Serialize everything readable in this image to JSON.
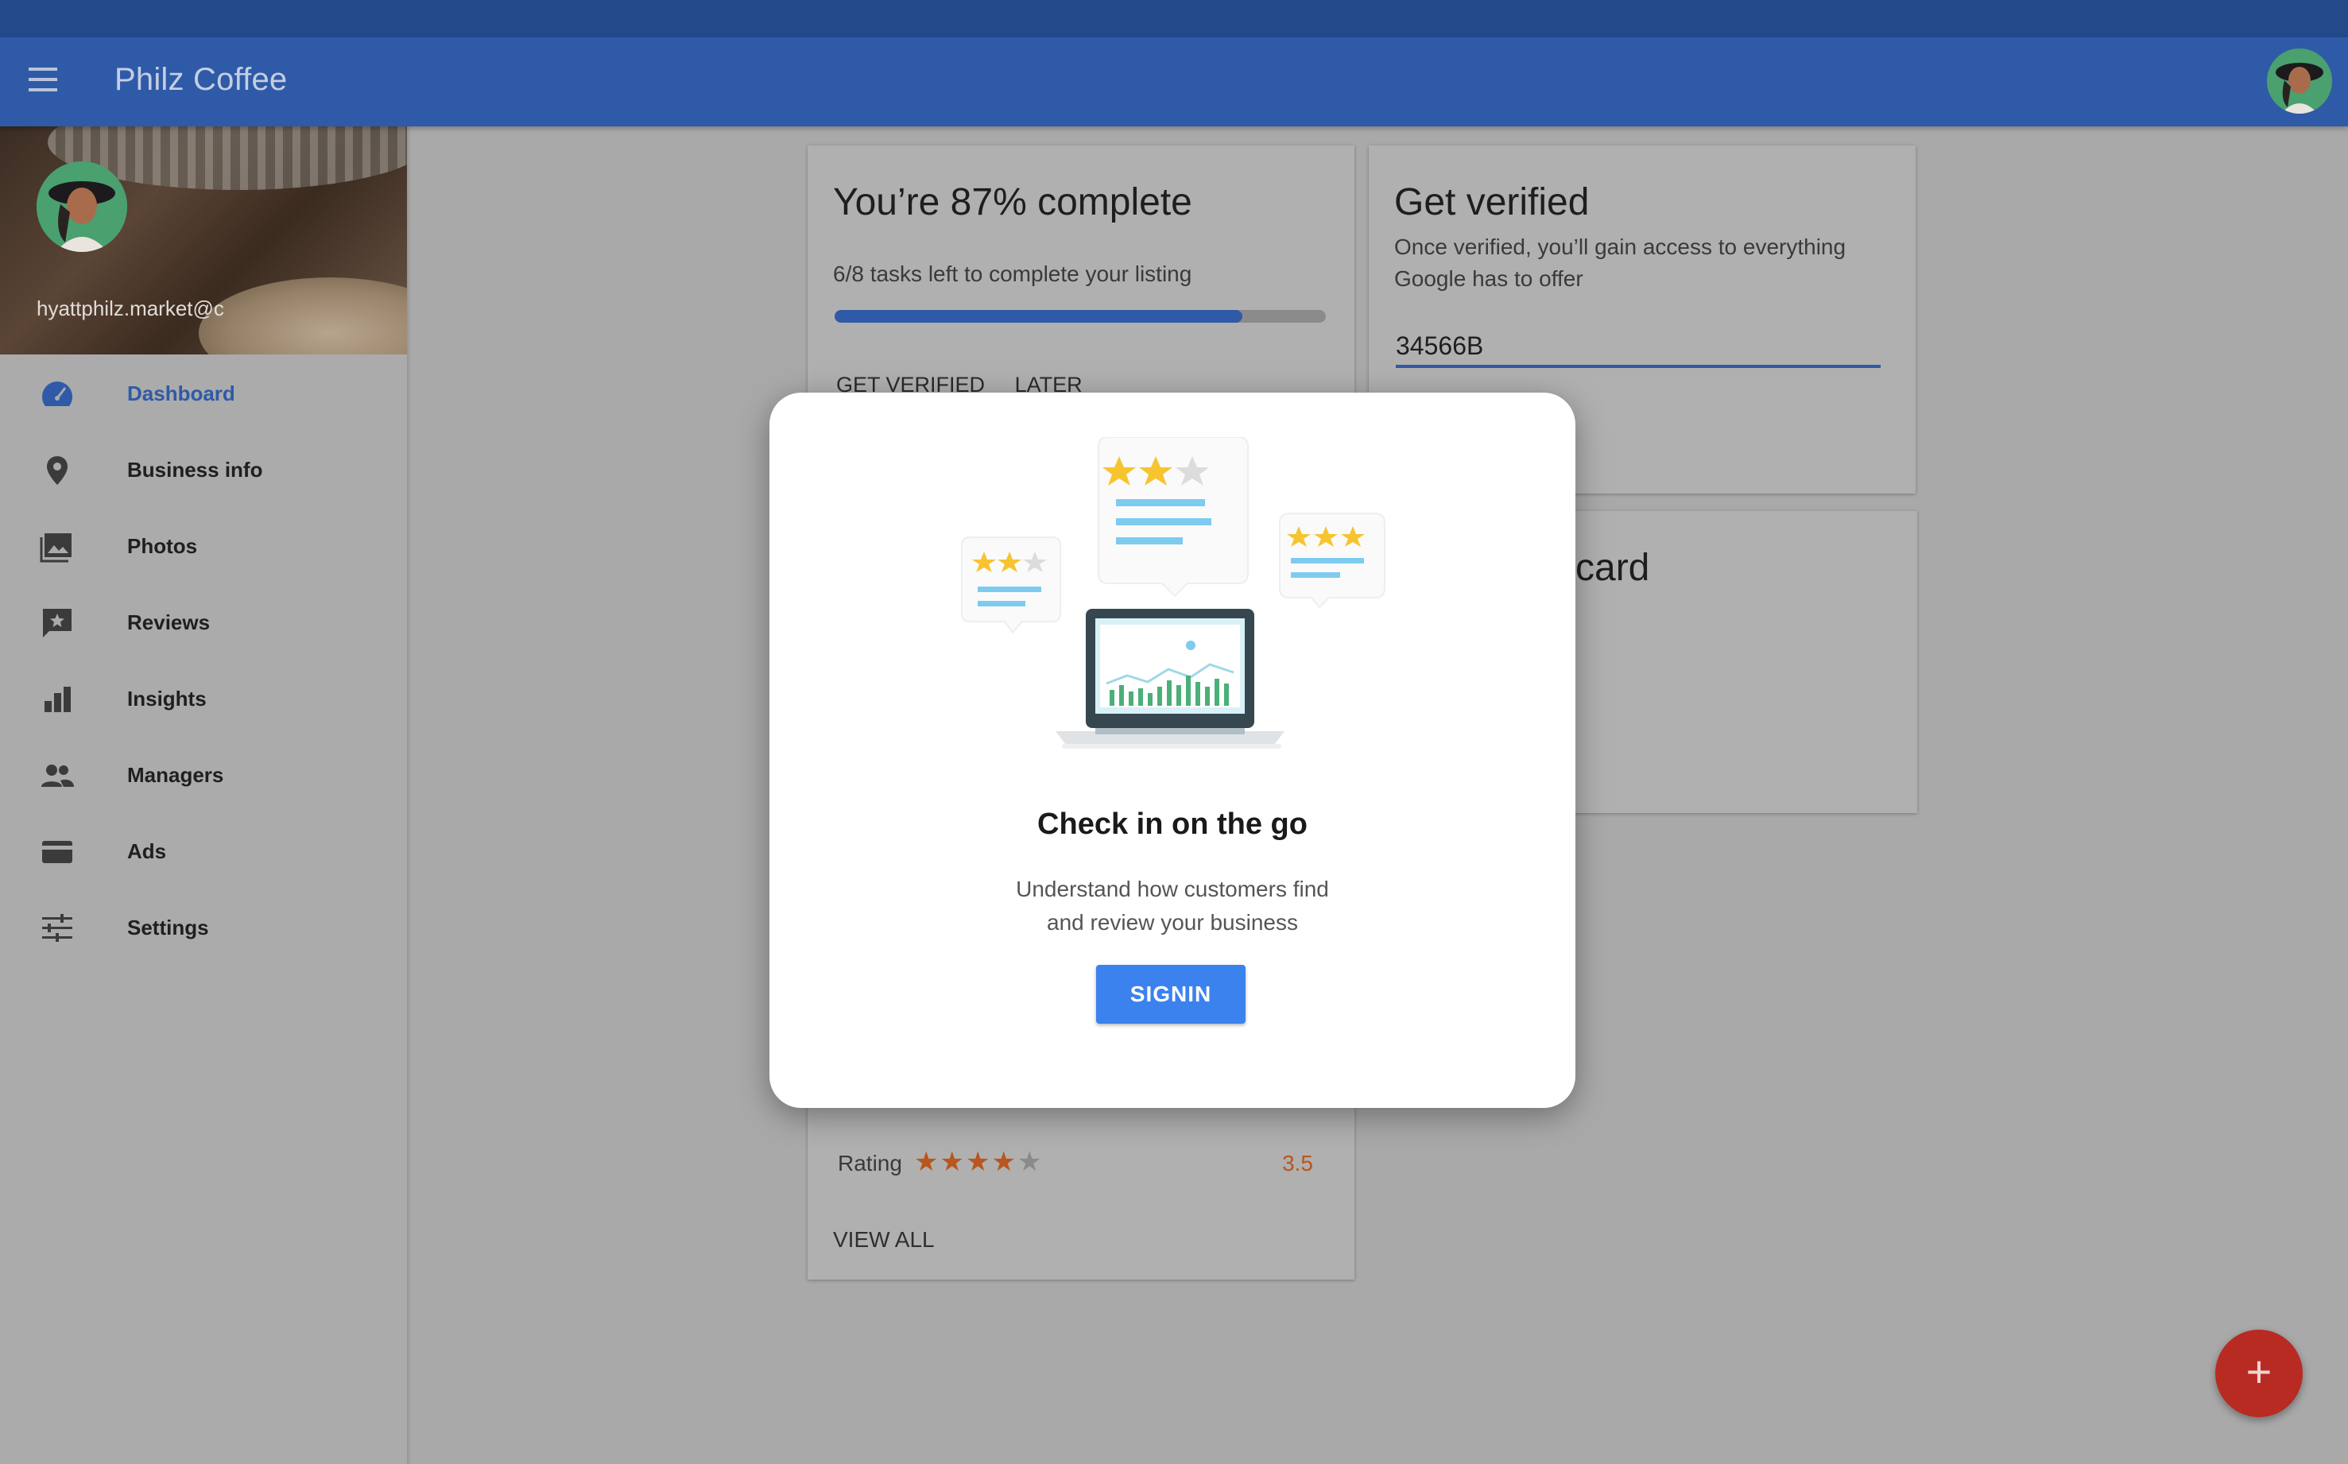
{
  "app": {
    "title": "Philz Coffee"
  },
  "drawer": {
    "email": "hyattphilz.market@c",
    "items": [
      {
        "label": "Dashboard",
        "icon": "dashboard-icon",
        "active": true
      },
      {
        "label": "Business info",
        "icon": "location-pin-icon"
      },
      {
        "label": "Photos",
        "icon": "photos-icon"
      },
      {
        "label": "Reviews",
        "icon": "reviews-icon"
      },
      {
        "label": "Insights",
        "icon": "bar-chart-icon"
      },
      {
        "label": "Managers",
        "icon": "people-icon"
      },
      {
        "label": "Ads",
        "icon": "credit-card-icon"
      },
      {
        "label": "Settings",
        "icon": "sliders-icon"
      }
    ]
  },
  "progress_card": {
    "title": "You’re 87% complete",
    "subtitle": "6/8 tasks left to complete your listing",
    "progress_fraction": 0.83,
    "action_verify": "GET VERIFIED",
    "action_later": "LATER"
  },
  "verify_card": {
    "title": "Get verified",
    "description": "Once verified, you’ll gain access to everything Google has to offer",
    "code_value": "34566B"
  },
  "business_card": {
    "title_fragment": "card"
  },
  "reviews_card": {
    "rating_label": "Rating",
    "rating_value": "3.5",
    "stars_filled": 4,
    "stars_total": 5,
    "view_all": "VIEW ALL"
  },
  "dialog": {
    "title": "Check in on the go",
    "body_line1": "Understand how customers find",
    "body_line2": "and review your business",
    "button": "SIGNIN"
  },
  "colors": {
    "primary": "#2f5aa7",
    "accent_button": "#3c82ee",
    "fab": "#b82b22",
    "star": "#b8561e"
  }
}
